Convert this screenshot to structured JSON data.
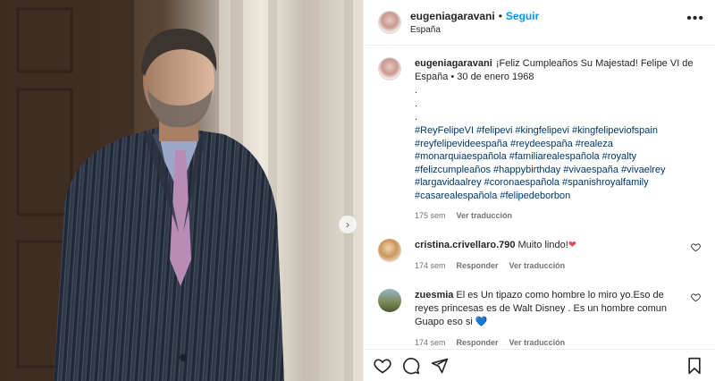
{
  "post": {
    "author": "eugeniagaravani",
    "follow_label": "Seguir",
    "separator": "•",
    "location": "España",
    "more_label": "•••"
  },
  "caption": {
    "author": "eugeniagaravani",
    "text": "¡Feliz Cumpleaños Su Majestad! Felipe VI de España • 30 de enero 1968",
    "dots": [
      ".",
      ".",
      "."
    ],
    "hashtags": [
      "#ReyFelipeVI",
      "#felipevi",
      "#kingfelipevi",
      "#kingfelipeviofspain",
      "#reyfelipevideespaña",
      "#reydeespaña",
      "#realeza",
      "#monarquiaespañola",
      "#familiarealespañola",
      "#royalty",
      "#felizcumpleaños",
      "#happybirthday",
      "#vivaespaña",
      "#vivaelrey",
      "#largavidaalrey",
      "#coronaespañola",
      "#spanishroyalfamily",
      "#casarealespañola",
      "#felipedeborbon"
    ],
    "time": "175 sem",
    "translate_label": "Ver traducción"
  },
  "comments": [
    {
      "user": "cristina.crivellaro.790",
      "text": "Muito lindo!",
      "emoji": "❤",
      "time": "174 sem",
      "reply_label": "Responder",
      "translate_label": "Ver traducción"
    },
    {
      "user": "zuesmia",
      "text": "El es Un tipazo como hombre lo miro yo.Eso de reyes princesas es de Walt Disney . Es un hombre comun Guapo eso si",
      "emoji": "💙",
      "time": "174 sem",
      "reply_label": "Responder",
      "translate_label": "Ver traducción"
    }
  ],
  "carousel": {
    "next_label": "›"
  },
  "icons": {
    "like": "heart-icon",
    "comment": "comment-icon",
    "share": "share-icon",
    "save": "bookmark-icon",
    "next": "chevron-right-icon"
  },
  "colors": {
    "accent": "#0095f6",
    "hashtag": "#00376b",
    "muted": "#737373",
    "heart": "#ed4956"
  }
}
